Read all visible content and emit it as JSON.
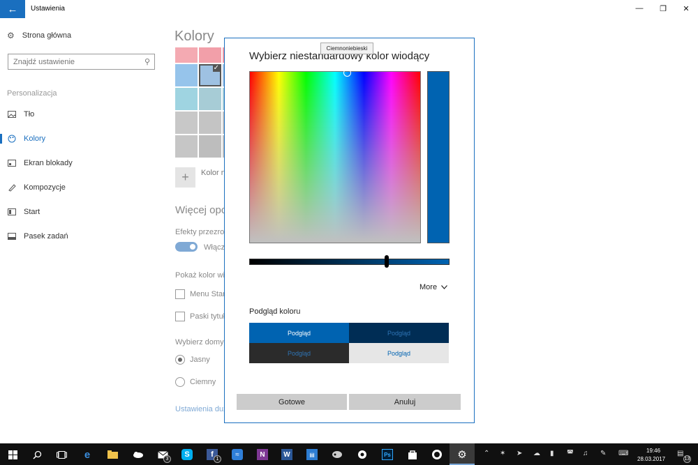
{
  "window": {
    "title": "Ustawienia",
    "back_icon": "arrow-left-icon",
    "minimize_glyph": "—",
    "restore_glyph": "❐",
    "close_glyph": "✕"
  },
  "sidebar": {
    "home": "Strona główna",
    "search_placeholder": "Znajdź ustawienie",
    "section": "Personalizacja",
    "items": [
      {
        "label": "Tło",
        "icon": "image-icon",
        "active": false
      },
      {
        "label": "Kolory",
        "icon": "palette-icon",
        "active": true
      },
      {
        "label": "Ekran blokady",
        "icon": "lock-screen-icon",
        "active": false
      },
      {
        "label": "Kompozycje",
        "icon": "brush-icon",
        "active": false
      },
      {
        "label": "Start",
        "icon": "start-icon",
        "active": false
      },
      {
        "label": "Pasek zadań",
        "icon": "taskbar-icon",
        "active": false
      }
    ]
  },
  "main": {
    "title": "Kolory",
    "swatches": [
      [
        "#f4aab2",
        "#f29fa9",
        "#f19aa5"
      ],
      [
        "#96c4eb",
        "#9ec1e2",
        "#a0c3e6"
      ],
      [
        "#9fd4e1",
        "#a7ccd6",
        "#a3cdd8"
      ],
      [
        "#c8c8c8",
        "#c4c4c4",
        "#c2c2c2"
      ],
      [
        "#c6c6c6",
        "#bdbdbd",
        "#c0c0c0"
      ]
    ],
    "selected_swatch": "1-1",
    "custom_color_label": "Kolor n",
    "more_options_heading": "Więcej opc",
    "transparency_label": "Efekty przezro",
    "toggle_label": "Włącz",
    "show_color_label": "Pokaż kolor wi",
    "check_start_label": "Menu Star",
    "check_title_label": "Paski tytuł",
    "mode_label": "Wybierz domy",
    "radio_light": "Jasny",
    "radio_dark": "Ciemny",
    "link": "Ustawienia duż"
  },
  "dialog": {
    "title": "Wybierz niestandardowy kolor wiodący",
    "tooltip": "Ciemnoniebieski",
    "selected_color": "#0063b1",
    "more_label": "More",
    "preview_heading": "Podgląd koloru",
    "previews": [
      {
        "label": "Podgląd",
        "bg": "#0063b1",
        "fg": "#ffffff"
      },
      {
        "label": "Podgląd",
        "bg": "#002d55",
        "fg": "#2e74b5"
      },
      {
        "label": "Podgląd",
        "bg": "#2b2b2b",
        "fg": "#2e74b5"
      },
      {
        "label": "Podgląd",
        "bg": "#e6e6e6",
        "fg": "#0063b1"
      }
    ],
    "ok_label": "Gotowe",
    "cancel_label": "Anuluj"
  },
  "taskbar": {
    "badges": [
      "3",
      "1"
    ],
    "clock_time": "19:46",
    "clock_date": "28.03.2017",
    "notification_count": "13",
    "icons": [
      "windows-start-icon",
      "search-icon",
      "task-view-icon",
      "edge-icon",
      "file-explorer-icon",
      "onedrive-icon",
      "mail-icon",
      "skype-icon",
      "facebook-icon",
      "messenger-icon",
      "onenote-icon",
      "word-icon",
      "news-icon",
      "game-icon",
      "bitwarden-icon",
      "photoshop-icon",
      "store-icon",
      "whatsapp-icon",
      "settings-icon"
    ]
  }
}
